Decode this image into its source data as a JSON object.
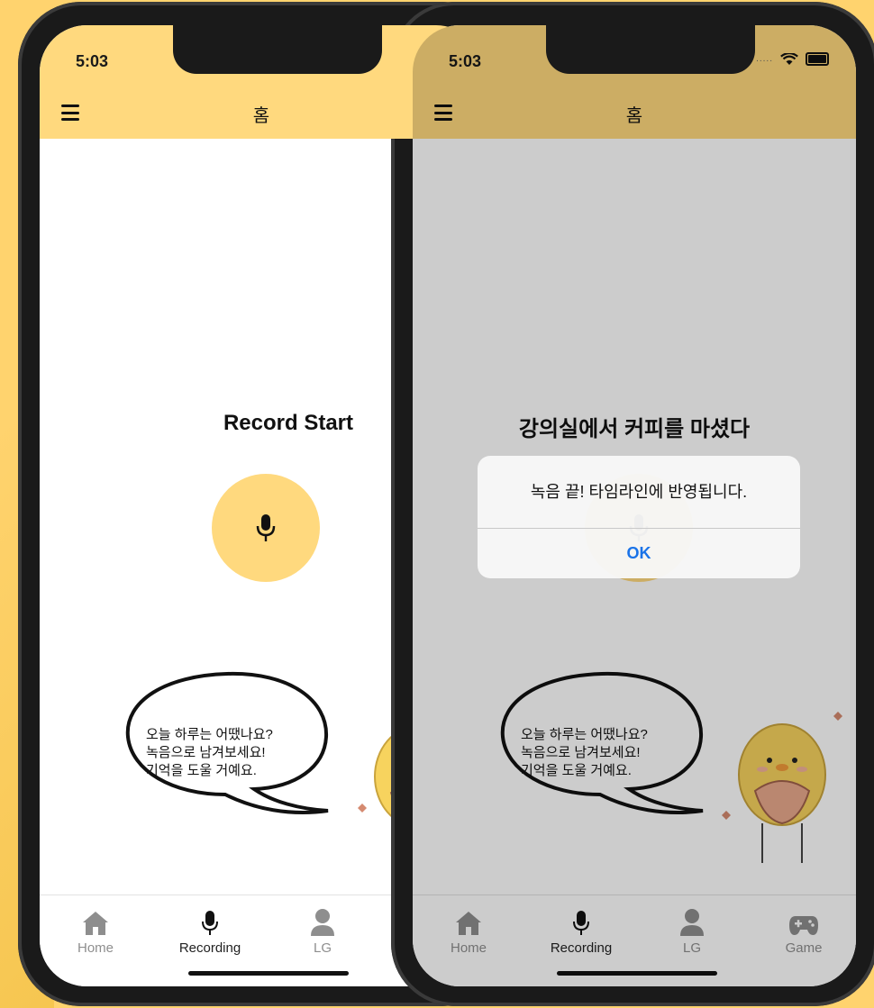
{
  "colors": {
    "background": "#ffd36e",
    "header": "#ffd97e",
    "accent_button": "#ffd97e",
    "ios_blue": "#1a73e8"
  },
  "left_phone": {
    "status": {
      "time": "5:03"
    },
    "header": {
      "menu_icon": "hamburger-icon",
      "title": "홈"
    },
    "main": {
      "title": "Record Start",
      "record_button_icon": "microphone-icon"
    },
    "speech_bubble": {
      "lines": [
        "오늘 하루는 어땠나요?",
        "녹음으로 남겨보세요!",
        "기억을 도울 거예요."
      ]
    },
    "tabs": [
      {
        "label": "Home",
        "icon": "home-icon"
      },
      {
        "label": "Recording",
        "icon": "microphone-icon"
      },
      {
        "label": "LG",
        "icon": "person-icon"
      }
    ]
  },
  "right_phone": {
    "status": {
      "time": "5:03",
      "signal": "....."
    },
    "header": {
      "menu_icon": "hamburger-icon",
      "title": "홈"
    },
    "main": {
      "title": "강의실에서 커피를 마셨다"
    },
    "alert": {
      "message": "녹음 끝! 타임라인에 반영됩니다.",
      "ok_label": "OK"
    },
    "speech_bubble": {
      "lines": [
        "오늘 하루는 어땠나요?",
        "녹음으로 남겨보세요!",
        "기억을 도울 거예요."
      ]
    },
    "tabs": [
      {
        "label": "Home",
        "icon": "home-icon"
      },
      {
        "label": "Recording",
        "icon": "microphone-icon"
      },
      {
        "label": "LG",
        "icon": "person-icon"
      },
      {
        "label": "Game",
        "icon": "gamepad-icon"
      }
    ]
  }
}
